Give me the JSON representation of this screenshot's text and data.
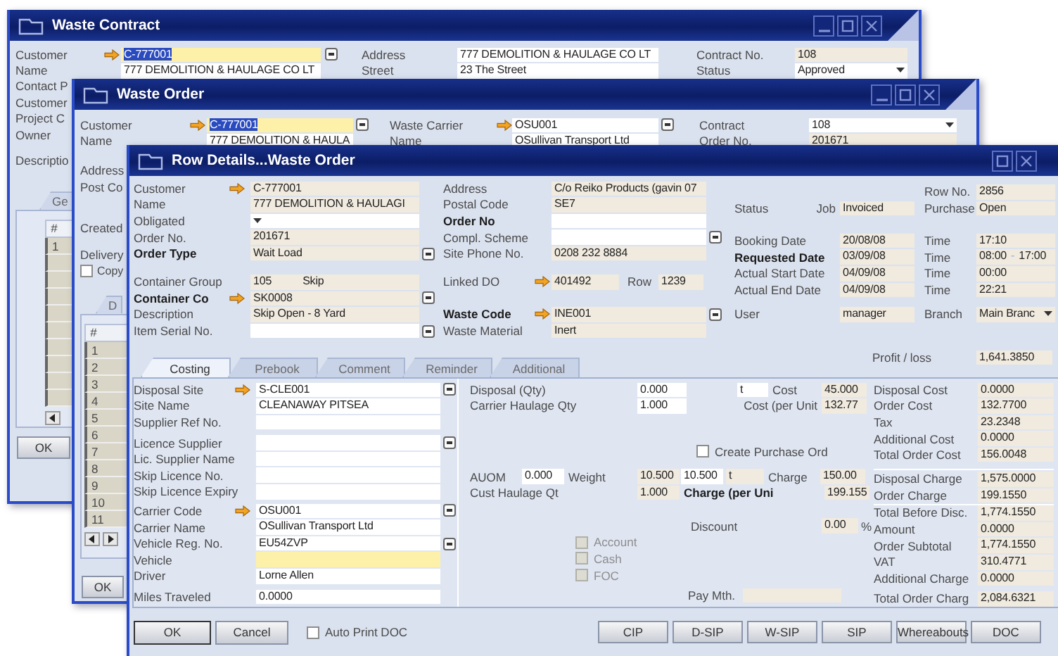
{
  "contract_window": {
    "title": "Waste Contract",
    "customer_fields": [
      {
        "label": "Customer",
        "value": "C-777001",
        "kind": "selected",
        "arrow": true,
        "lookup": true
      },
      {
        "label": "Name",
        "value": "777 DEMOLITION & HAULAGE CO LT",
        "kind": "edit"
      }
    ],
    "address_fields": [
      {
        "label": "Address",
        "value": "777 DEMOLITION & HAULAGE CO LT",
        "kind": "edit"
      },
      {
        "label": "Street",
        "value": "23 The Street",
        "kind": "edit"
      }
    ],
    "contract_fields": [
      {
        "label": "Contract No.",
        "value": "108",
        "kind": "readonly"
      },
      {
        "label": "Status",
        "value": "Approved",
        "kind": "dropdown"
      }
    ],
    "side_labels": [
      "Contact P",
      "Customer",
      "Project C",
      "Owner"
    ],
    "description_label": "Descriptio",
    "tab": "Ge",
    "grid": {
      "header": "#",
      "rows": [
        "1"
      ]
    },
    "ok_button": "OK"
  },
  "order_window": {
    "title": "Waste Order",
    "customer_fields": [
      {
        "label": "Customer",
        "value": "C-777001",
        "kind": "selected",
        "arrow": true,
        "lookup": true
      },
      {
        "label": "Name",
        "value": "777 DEMOLITION & HAULA",
        "kind": "edit"
      }
    ],
    "carrier_fields": [
      {
        "label": "Waste Carrier",
        "value": "OSU001",
        "kind": "edit",
        "arrow": true,
        "lookup": true
      },
      {
        "label": "Name",
        "value": "OSullivan Transport Ltd",
        "kind": "edit"
      }
    ],
    "contract_fields": [
      {
        "label": "Contract",
        "value": "108",
        "kind": "dropdown"
      },
      {
        "label": "Order No.",
        "value": "201671",
        "kind": "readonly"
      }
    ],
    "side_labels": [
      "Address",
      "Post Co"
    ],
    "created_label": "Created",
    "delivery_label": "Delivery",
    "copy_check": {
      "label": "Copy",
      "checked": false
    },
    "tab": "D",
    "grid": {
      "header": "#",
      "rows": [
        "1",
        "2",
        "3",
        "4",
        "5",
        "6",
        "7",
        "8",
        "9",
        "10",
        "11"
      ]
    },
    "ok_button": "OK"
  },
  "row_details_window": {
    "title": "Row Details...Waste Order",
    "customer_fields": [
      {
        "label": "Customer",
        "value": "C-777001",
        "kind": "readonly",
        "arrow": true
      },
      {
        "label": "Name",
        "value": "777 DEMOLITION & HAULAGI",
        "kind": "readonly"
      },
      {
        "label": "Obligated",
        "kind": "dropdown"
      },
      {
        "label": "Order No.",
        "value": "201671",
        "kind": "readonly"
      },
      {
        "label": "Order Type",
        "value": "Wait Load",
        "kind": "readonly",
        "bold": true,
        "lookup": true
      }
    ],
    "container_fields": [
      {
        "label": "Container Group",
        "value": "105",
        "value_2": "Skip",
        "kind": "readonly"
      },
      {
        "label": "Container Co",
        "value": "SK0008",
        "kind": "readonly",
        "bold": true,
        "arrow": true,
        "lookup": true
      },
      {
        "label": "Description",
        "value": "Skip Open - 8 Yard",
        "kind": "readonly"
      },
      {
        "label": "Item Serial No.",
        "kind": "edit",
        "lookup": true
      }
    ],
    "site_fields": [
      {
        "label": "Address",
        "value": "C/o Reiko Products (gavin 07",
        "kind": "readonly"
      },
      {
        "label": "Postal Code",
        "value": "SE7",
        "kind": "readonly"
      },
      {
        "label": "Order No",
        "kind": "edit",
        "bold": true
      },
      {
        "label": "Compl. Scheme",
        "kind": "edit",
        "lookup": true
      },
      {
        "label": "Site Phone No.",
        "value": "0208 232 8884",
        "kind": "readonly"
      }
    ],
    "linked_do": {
      "label": "Linked DO",
      "value": "401492",
      "row_label": "Row",
      "row": "1239"
    },
    "waste_fields": [
      {
        "label": "Waste Code",
        "value": "INE001",
        "kind": "readonly",
        "bold": true,
        "arrow": true,
        "lookup": true
      },
      {
        "label": "Waste Material",
        "value": "Inert",
        "kind": "readonly"
      }
    ],
    "row_no": {
      "label": "Row No.",
      "value": "2856"
    },
    "status": {
      "label": "Status",
      "job_label": "Job",
      "job_status": "Invoiced",
      "purchase_label": "Purchase",
      "purchase_status": "Open"
    },
    "dates": [
      {
        "label": "Booking Date",
        "value": "20/08/08",
        "time_label": "Time",
        "time": "17:10"
      },
      {
        "label": "Requested Date",
        "bold": true,
        "value": "03/09/08",
        "time_label": "Time",
        "time": "08:00",
        "time_separator": "-",
        "time_end": "17:00"
      },
      {
        "label": "Actual Start Date",
        "value": "04/09/08",
        "time_label": "Time",
        "time": "00:00"
      },
      {
        "label": "Actual End Date",
        "value": "04/09/08",
        "time_label": "Time",
        "time": "22:21"
      }
    ],
    "user": {
      "label": "User",
      "value": "manager",
      "branch_label": "Branch",
      "branch": "Main Branc"
    },
    "tabs": [
      {
        "label": "Costing",
        "selected": true
      },
      {
        "label": "Prebook",
        "selected": false
      },
      {
        "label": "Comment",
        "selected": false
      },
      {
        "label": "Reminder",
        "selected": false
      },
      {
        "label": "Additional",
        "selected": false
      }
    ],
    "profit": {
      "label": "Profit / loss",
      "value": "1,641.3850"
    },
    "site_group": [
      {
        "label": "Disposal Site",
        "value": "S-CLE001",
        "kind": "edit",
        "arrow": true,
        "lookup": true
      },
      {
        "label": "Site Name",
        "value": "CLEANAWAY PITSEA",
        "kind": "edit"
      },
      {
        "label": "Supplier Ref No.",
        "kind": "edit"
      }
    ],
    "licence_group": [
      {
        "label": "Licence Supplier",
        "kind": "edit",
        "lookup": true
      },
      {
        "label": "Lic. Supplier Name",
        "kind": "edit"
      },
      {
        "label": "Skip Licence No.",
        "kind": "edit"
      },
      {
        "label": "Skip Licence Expiry",
        "kind": "edit"
      }
    ],
    "carrier_group": [
      {
        "label": "Carrier Code",
        "value": "OSU001",
        "kind": "edit",
        "arrow": true,
        "lookup": true
      },
      {
        "label": "Carrier Name",
        "value": "OSullivan Transport Ltd",
        "kind": "edit"
      },
      {
        "label": "Vehicle Reg. No.",
        "value": "EU54ZVP",
        "kind": "edit",
        "lookup": true
      },
      {
        "label": "Vehicle",
        "kind": "focus"
      },
      {
        "label": "Driver",
        "value": "Lorne Allen",
        "kind": "edit"
      }
    ],
    "miles_group": [
      {
        "label": "Miles Traveled",
        "value": "0.0000",
        "kind": "edit"
      }
    ],
    "quantities": [
      {
        "label": "Disposal (Qty)",
        "value": "0.000",
        "unit": "t",
        "cost_label": "Cost",
        "cost": "45.000"
      },
      {
        "label": "Carrier Haulage Qty",
        "value": "1.000",
        "cost_label": "Cost (per Unit",
        "cost": "132.77"
      }
    ],
    "create_purchase": {
      "label": "Create Purchase Ord",
      "checked": false
    },
    "weights": [
      {
        "label": "AUOM",
        "value": "0.000",
        "weight_label": "Weight",
        "weight": "10.500",
        "weight_2": "10.500",
        "unit": "t",
        "charge_label": "Charge",
        "charge": "150.00"
      },
      {
        "label": "Cust Haulage Qt",
        "weight": "1.000",
        "charge_label": "Charge (per Uni",
        "charge_bold": true,
        "charge": "199.155"
      }
    ],
    "discount": {
      "label": "Discount",
      "value": "0.00",
      "unit": "%"
    },
    "payment_checks": [
      {
        "label": "Account",
        "checked": false,
        "disabled": true
      },
      {
        "label": "Cash",
        "checked": false,
        "disabled": true
      },
      {
        "label": "FOC",
        "checked": false,
        "disabled": true
      }
    ],
    "pay_method": {
      "label": "Pay Mth."
    },
    "costs": [
      {
        "label": "Disposal Cost",
        "value": "0.0000"
      },
      {
        "label": "Order Cost",
        "value": "132.7700"
      },
      {
        "label": "Tax",
        "value": "23.2348"
      },
      {
        "label": "Additional Cost",
        "value": "0.0000"
      },
      {
        "label": "Total Order Cost",
        "value": "156.0048"
      }
    ],
    "charges": [
      {
        "label": "Disposal Charge",
        "value": "1,575.0000"
      },
      {
        "label": "Order Charge",
        "value": "199.1550"
      }
    ],
    "totals": [
      {
        "label": "Total Before Disc.",
        "value": "1,774.1550"
      },
      {
        "label": "Amount",
        "value": "0.0000"
      },
      {
        "label": "Order Subtotal",
        "value": "1,774.1550"
      },
      {
        "label": "VAT",
        "value": "310.4771"
      },
      {
        "label": "Additional Charge",
        "value": "0.0000"
      },
      {
        "label": "Total Order Charg",
        "value": "2,084.6321"
      }
    ],
    "ok_button": "OK",
    "cancel_button": "Cancel",
    "auto_print": {
      "label": "Auto Print DOC",
      "checked": false
    },
    "action_buttons": [
      "CIP",
      "D-SIP",
      "W-SIP",
      "SIP",
      "Whereabouts",
      "DOC"
    ]
  }
}
